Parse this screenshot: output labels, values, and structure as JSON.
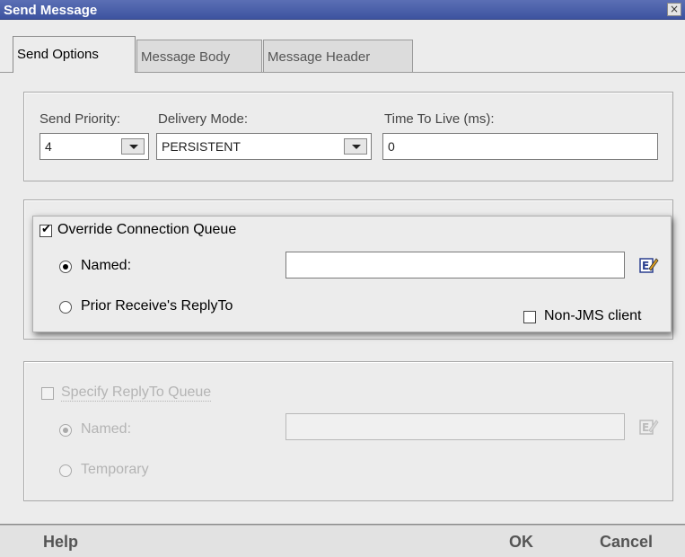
{
  "window": {
    "title": "Send Message",
    "close_glyph": "×"
  },
  "tabs": [
    {
      "label": "Send Options",
      "active": true
    },
    {
      "label": "Message Body",
      "active": false
    },
    {
      "label": "Message Header",
      "active": false
    }
  ],
  "send_options": {
    "priority_label": "Send Priority:",
    "priority_value": "4",
    "delivery_label": "Delivery Mode:",
    "delivery_value": "PERSISTENT",
    "ttl_label": "Time To Live (ms):",
    "ttl_value": "0"
  },
  "override": {
    "checkbox_label": "Override Connection Queue",
    "checked": true,
    "named_label": "Named:",
    "named_value": "",
    "prior_label": "Prior Receive's ReplyTo",
    "nonjms_label": "Non-JMS client",
    "edit_icon": "edit-icon"
  },
  "replyto": {
    "checkbox_label": "Specify ReplyTo Queue",
    "checked": false,
    "named_label": "Named:",
    "named_value": "",
    "temporary_label": "Temporary",
    "edit_icon": "edit-icon"
  },
  "footer": {
    "help": "Help",
    "ok": "OK",
    "cancel": "Cancel"
  },
  "colors": {
    "title_bar": "#3d53a0",
    "background": "#ececec",
    "disabled_text": "#b4b4b4"
  }
}
